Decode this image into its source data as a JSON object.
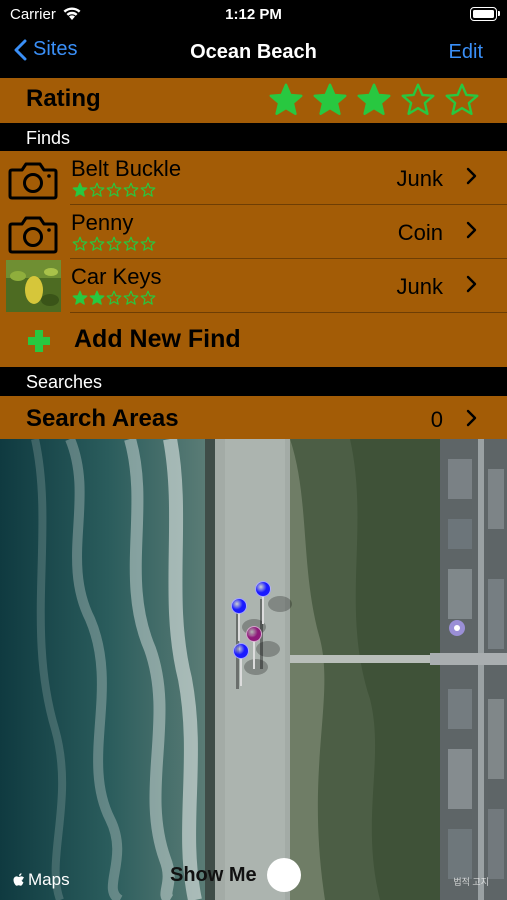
{
  "status_bar": {
    "carrier": "Carrier",
    "time": "1:12 PM"
  },
  "nav": {
    "back_label": "Sites",
    "title": "Ocean Beach",
    "edit_label": "Edit"
  },
  "rating": {
    "label": "Rating",
    "value": 3,
    "max": 5
  },
  "finds_section": {
    "header": "Finds",
    "items": [
      {
        "name": "Belt Buckle",
        "category": "Junk",
        "stars": 1,
        "thumbnail": "camera-icon"
      },
      {
        "name": "Penny",
        "category": "Coin",
        "stars": 0,
        "thumbnail": "camera-icon"
      },
      {
        "name": "Car Keys",
        "category": "Junk",
        "stars": 2,
        "thumbnail": "photo-thumbnail"
      }
    ],
    "add_label": "Add New Find"
  },
  "searches_section": {
    "header": "Searches",
    "areas_label": "Search Areas",
    "areas_count": "0"
  },
  "map": {
    "attribution": "Maps",
    "legal": "법적 고지",
    "show_me_label": "Show Me",
    "pins": [
      {
        "color": "#1a1aff"
      },
      {
        "color": "#1a1aff"
      },
      {
        "color": "#8e1a7a"
      },
      {
        "color": "#1a1aff"
      }
    ]
  },
  "colors": {
    "row_background": "#a35c06",
    "accent_blue": "#3a8ff7",
    "star_green": "#28c840"
  }
}
